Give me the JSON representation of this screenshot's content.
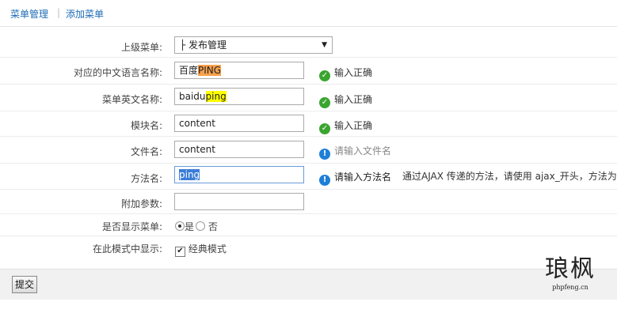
{
  "topbar": {
    "tab_manage": "菜单管理",
    "separator": "|",
    "tab_add": "添加菜单"
  },
  "form": {
    "parent": {
      "label": "上级菜单:",
      "value": "├ 发布管理"
    },
    "cn_name": {
      "label": "对应的中文语言名称:",
      "value_plain": "百度",
      "value_highlight": "PING",
      "status": "输入正确"
    },
    "en_name": {
      "label": "菜单英文名称:",
      "value_plain": "baidu",
      "value_highlight": "ping",
      "status": "输入正确"
    },
    "module": {
      "label": "模块名:",
      "value": "content",
      "status": "输入正确"
    },
    "file": {
      "label": "文件名:",
      "value": "content",
      "status": "请输入文件名"
    },
    "method": {
      "label": "方法名:",
      "value": "ping",
      "status": "请输入方法名",
      "hint": "通过AJAX 传递的方法，请使用 ajax_开头，方法为简"
    },
    "params": {
      "label": "附加参数:",
      "value": ""
    },
    "display": {
      "label": "是否显示菜单:",
      "yes": "是",
      "no": "否",
      "selected": "yes"
    },
    "mode": {
      "label": "在此模式中显示:",
      "option": "经典模式",
      "checked": true
    }
  },
  "footer": {
    "submit_label": "提交"
  },
  "watermark": {
    "big": "琅枫",
    "small": "phpfeng.cn"
  },
  "colors": {
    "link": "#1d6bb5",
    "ok": "#3aa530",
    "info": "#1e7fd8",
    "highlight_orange": "#f7a04c",
    "highlight_yellow": "#ffff00"
  }
}
